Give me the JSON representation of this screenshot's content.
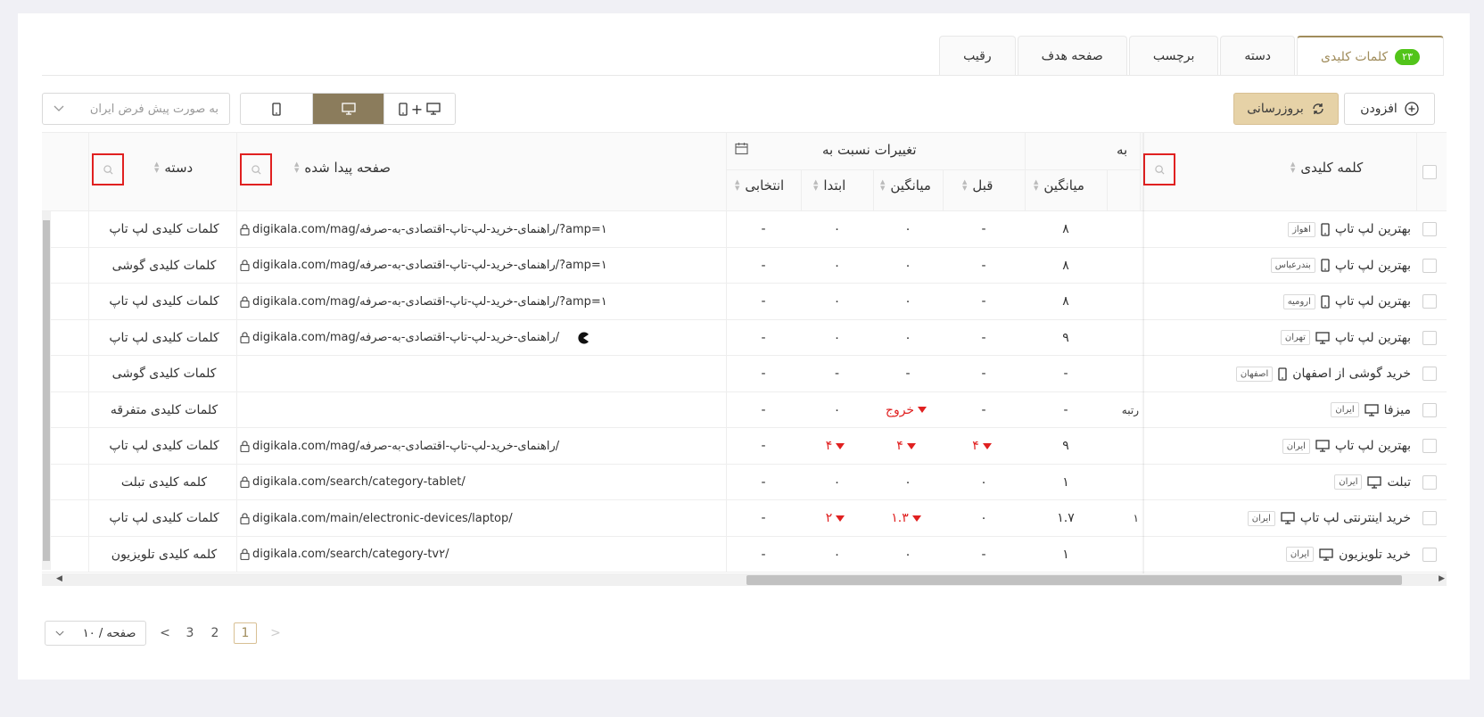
{
  "tabs": [
    {
      "label": "کلمات کلیدی",
      "badge": "۲۳",
      "active": true
    },
    {
      "label": "دسته"
    },
    {
      "label": "برچسب"
    },
    {
      "label": "صفحه هدف"
    },
    {
      "label": "رقیب"
    }
  ],
  "toolbar": {
    "add_label": "افزودن",
    "refresh_label": "بروزرسانی",
    "devices": [
      "desktop+mobile",
      "desktop",
      "mobile"
    ],
    "active_device": "desktop",
    "plus_glyph": "+",
    "region_placeholder": "به صورت پیش فرض ایران"
  },
  "table": {
    "headers": {
      "keyword": "کلمه کلیدی",
      "rank_group": "به",
      "rank_partial": "رتبه",
      "changes_group": "تغییرات نسبت به",
      "avg": "میانگین",
      "prev": "قبل",
      "avg2": "میانگین",
      "start": "ابتدا",
      "selected": "انتخابی",
      "found_page": "صفحه پیدا شده",
      "category": "دسته"
    },
    "rows": [
      {
        "keyword": "بهترین لپ تاپ",
        "device": "mobile",
        "city": "اهواز",
        "avg": "۸",
        "prev": "-",
        "avg2": "۰",
        "start": "۰",
        "selected": "-",
        "url": "digikala.com/mag/راهنمای-خرید-لپ-تاپ-اقتصادی-به-صرفه/?amp=۱",
        "category": "کلمات کلیدی لپ تاپ"
      },
      {
        "keyword": "بهترین لپ تاپ",
        "device": "mobile",
        "city": "بندرعباس",
        "avg": "۸",
        "prev": "-",
        "avg2": "۰",
        "start": "۰",
        "selected": "-",
        "url": "digikala.com/mag/راهنمای-خرید-لپ-تاپ-اقتصادی-به-صرفه/?amp=۱",
        "category": "کلمات کلیدی گوشی"
      },
      {
        "keyword": "بهترین لپ تاپ",
        "device": "mobile",
        "city": "ارومیه",
        "avg": "۸",
        "prev": "-",
        "avg2": "۰",
        "start": "۰",
        "selected": "-",
        "url": "digikala.com/mag/راهنمای-خرید-لپ-تاپ-اقتصادی-به-صرفه/?amp=۱",
        "category": "کلمات کلیدی لپ تاپ"
      },
      {
        "keyword": "بهترین لپ تاپ",
        "device": "desktop",
        "city": "تهران",
        "avg": "۹",
        "prev": "-",
        "avg2": "۰",
        "start": "۰",
        "selected": "-",
        "url": "digikala.com/mag/راهنمای-خرید-لپ-تاپ-اقتصادی-به-صرفه/",
        "url_icon": "pacman",
        "category": "کلمات کلیدی لپ تاپ"
      },
      {
        "keyword": "خرید گوشی از اصفهان",
        "device": "mobile",
        "city": "اصفهان",
        "avg": "-",
        "prev": "-",
        "avg2": "-",
        "start": "-",
        "selected": "-",
        "url": "",
        "category": "کلمات کلیدی گوشی"
      },
      {
        "keyword": "میزفا",
        "device": "desktop",
        "city": "ایران",
        "rank_partial": "رتبه",
        "avg": "-",
        "prev": "-",
        "avg2": "خروج",
        "start": "۰",
        "selected": "-",
        "url": "",
        "category": "کلمات کلیدی متفرقه"
      },
      {
        "keyword": "بهترین لپ تاپ",
        "device": "desktop",
        "city": "ایران",
        "avg": "۹",
        "prev": "۴",
        "avg2": "۴",
        "start": "۴",
        "selected": "-",
        "url": "digikala.com/mag/راهنمای-خرید-لپ-تاپ-اقتصادی-به-صرفه/",
        "category": "کلمات کلیدی لپ تاپ"
      },
      {
        "keyword": "تبلت",
        "device": "desktop",
        "city": "ایران",
        "avg": "۱",
        "prev": "۰",
        "avg2": "۰",
        "start": "۰",
        "selected": "-",
        "url": "digikala.com/search/category-tablet/",
        "category": "کلمه کلیدی تبلت"
      },
      {
        "keyword": "خرید اینترنتی لپ تاپ",
        "device": "desktop",
        "city": "ایران",
        "rank_partial": "۱",
        "avg": "۱.۷",
        "prev": "۰",
        "avg2": "۱.۳",
        "start": "۲",
        "selected": "-",
        "url": "digikala.com/main/electronic-devices/laptop/",
        "category": "کلمات کلیدی لپ تاپ"
      },
      {
        "keyword": "خرید تلویزیون",
        "device": "desktop",
        "city": "ایران",
        "avg": "۱",
        "prev": "-",
        "avg2": "۰",
        "start": "۰",
        "selected": "-",
        "url": "digikala.com/search/category-tv۲/",
        "category": "کلمه کلیدی تلویزیون"
      }
    ]
  },
  "pagination": {
    "page_size": "۱۰ / صفحه",
    "pages": [
      "1",
      "2",
      "3"
    ],
    "current": "1"
  }
}
